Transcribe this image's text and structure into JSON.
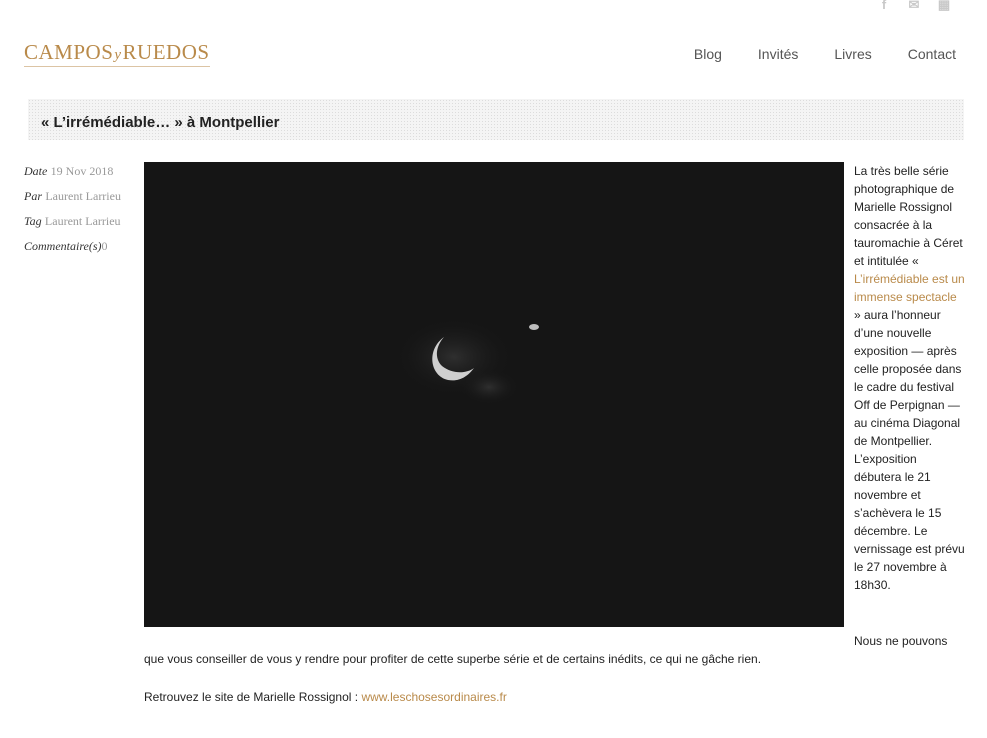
{
  "social": {
    "icons": [
      "facebook-icon",
      "twitter-icon",
      "share-icon"
    ]
  },
  "logo": {
    "part1": "CAMPOS",
    "y": "y",
    "part2": "RUEDOS"
  },
  "nav": [
    "Blog",
    "Invités",
    "Livres",
    "Contact"
  ],
  "post": {
    "title": "« L’irrémédiable… » à Montpellier",
    "meta": {
      "date_label": "Date",
      "date": "19 Nov 2018",
      "author_label": "Par",
      "author": "Laurent Larrieu",
      "tag_label": "Tag",
      "tag": "Laurent Larrieu",
      "comments_label": "Commentaire(s)",
      "comments": "0"
    },
    "intro_before": "La très belle série photographique de Marielle Rossignol consacrée à la tauromachie à Céret et intitulée «",
    "series_link": "L’irrémédiable est un immense spectacle",
    "intro_after": "» aura l’honneur d’une nouvelle exposition — après celle proposée dans le cadre du festival Off de Perpignan — au cinéma Diagonal de Montpellier. L’exposition débutera le 21 novembre et s’achèvera le 15 décembre. Le vernissage est prévu le 27 novembre à 18h30.",
    "p2_part1": "Nous ne pouvons",
    "p2_part2": "que vous conseiller de vous y rendre pour profiter de cette superbe série et de certains inédits, ce qui ne gâche rien.",
    "p3_text": "Retrouvez le site de Marielle Rossignol :",
    "p3_link": "www.leschosesordinaires.fr"
  }
}
